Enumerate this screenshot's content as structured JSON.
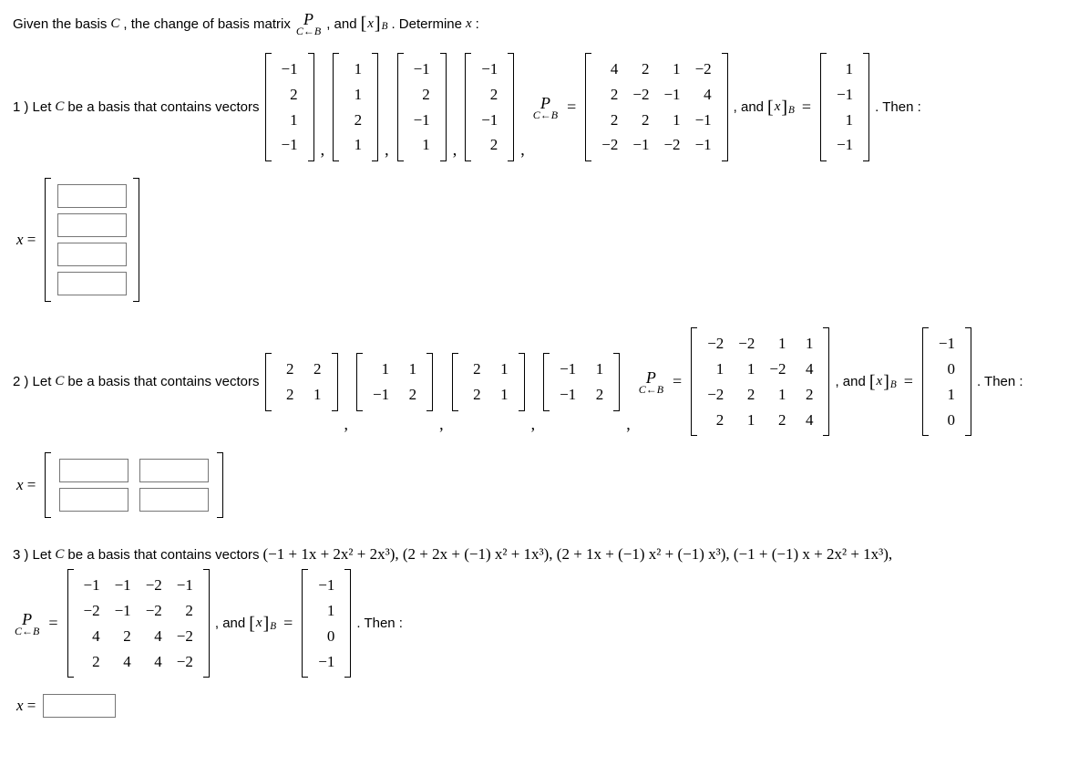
{
  "intro": {
    "t1": "Given the basis ",
    "C": "C",
    "t2": ", the change of basis matrix ",
    "P_top": "P",
    "P_bot": "C←B",
    "t3": ", and ",
    "xB_l": "[",
    "xB_x": "x",
    "xB_r": "]",
    "xB_B": "B",
    "t4": ". Determine ",
    "xvar": "x",
    "t5": ":"
  },
  "labels": {
    "let_pre": ") Let ",
    "let_post": " be a basis that contains vectors",
    "and": ", and ",
    "then": ". Then :",
    "xeq": "x =",
    "comma": ",",
    "eq": "="
  },
  "p1": {
    "num": "1",
    "v1": [
      [
        "−1"
      ],
      [
        "2"
      ],
      [
        "1"
      ],
      [
        "−1"
      ]
    ],
    "v2": [
      [
        "1"
      ],
      [
        "1"
      ],
      [
        "2"
      ],
      [
        "1"
      ]
    ],
    "v3": [
      [
        "−1"
      ],
      [
        "2"
      ],
      [
        "−1"
      ],
      [
        "1"
      ]
    ],
    "v4": [
      [
        "−1"
      ],
      [
        "2"
      ],
      [
        "−1"
      ],
      [
        "2"
      ]
    ],
    "P": [
      [
        "4",
        "2",
        "1",
        "−2"
      ],
      [
        "2",
        "−2",
        "−1",
        "4"
      ],
      [
        "2",
        "2",
        "1",
        "−1"
      ],
      [
        "−2",
        "−1",
        "−2",
        "−1"
      ]
    ],
    "xB": [
      [
        "1"
      ],
      [
        "−1"
      ],
      [
        "1"
      ],
      [
        "−1"
      ]
    ]
  },
  "p2": {
    "num": "2",
    "v1": [
      [
        "2",
        "2"
      ],
      [
        "2",
        "1"
      ]
    ],
    "v2": [
      [
        "1",
        "1"
      ],
      [
        "−1",
        "2"
      ]
    ],
    "v3": [
      [
        "2",
        "1"
      ],
      [
        "2",
        "1"
      ]
    ],
    "v4": [
      [
        "−1",
        "1"
      ],
      [
        "−1",
        "2"
      ]
    ],
    "P": [
      [
        "−2",
        "−2",
        "1",
        "1"
      ],
      [
        "1",
        "1",
        "−2",
        "4"
      ],
      [
        "−2",
        "2",
        "1",
        "2"
      ],
      [
        "2",
        "1",
        "2",
        "4"
      ]
    ],
    "xB": [
      [
        "−1"
      ],
      [
        "0"
      ],
      [
        "1"
      ],
      [
        "0"
      ]
    ]
  },
  "p3": {
    "num": "3",
    "vectors": "(−1 + 1x + 2x² + 2x³), (2 + 2x + (−1) x² + 1x³), (2 + 1x + (−1) x² + (−1) x³), (−1 + (−1) x + 2x² + 1x³),",
    "P": [
      [
        "−1",
        "−1",
        "−2",
        "−1"
      ],
      [
        "−2",
        "−1",
        "−2",
        "2"
      ],
      [
        "4",
        "2",
        "4",
        "−2"
      ],
      [
        "2",
        "4",
        "4",
        "−2"
      ]
    ],
    "xB": [
      [
        "−1"
      ],
      [
        "1"
      ],
      [
        "0"
      ],
      [
        "−1"
      ]
    ]
  }
}
